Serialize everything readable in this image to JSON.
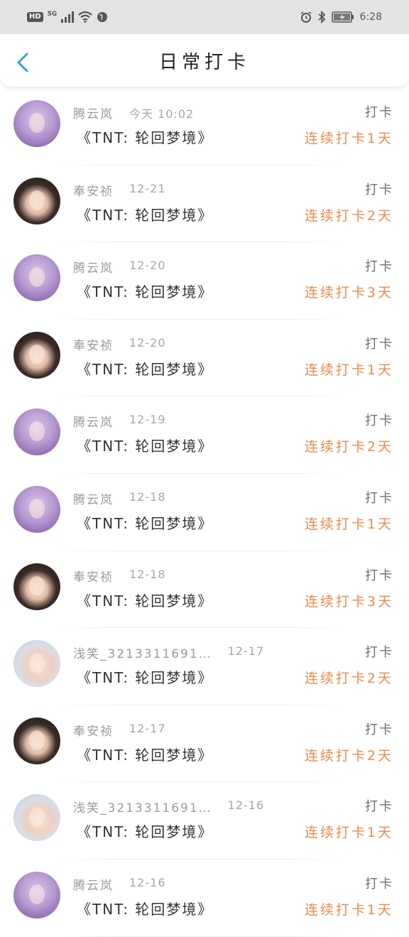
{
  "status_bar": {
    "hd": "HD",
    "network": "5G",
    "time": "6:28"
  },
  "header": {
    "title": "日常打卡"
  },
  "colors": {
    "accent": "#ec8a4c",
    "back_arrow": "#2f9ee0"
  },
  "items": [
    {
      "avatar": "purple-girl-avatar",
      "name": "腾云岚",
      "time": "今天 10:02",
      "tag": "打卡",
      "book": "《TNT: 轮回梦境》",
      "streak": "连续打卡1天"
    },
    {
      "avatar": "dark-hair-girl-avatar",
      "name": "奉安祯",
      "time": "12-21",
      "tag": "打卡",
      "book": "《TNT: 轮回梦境》",
      "streak": "连续打卡2天"
    },
    {
      "avatar": "purple-girl-avatar",
      "name": "腾云岚",
      "time": "12-20",
      "tag": "打卡",
      "book": "《TNT: 轮回梦境》",
      "streak": "连续打卡3天"
    },
    {
      "avatar": "dark-hair-girl-avatar",
      "name": "奉安祯",
      "time": "12-20",
      "tag": "打卡",
      "book": "《TNT: 轮回梦境》",
      "streak": "连续打卡1天"
    },
    {
      "avatar": "purple-girl-avatar",
      "name": "腾云岚",
      "time": "12-19",
      "tag": "打卡",
      "book": "《TNT: 轮回梦境》",
      "streak": "连续打卡2天"
    },
    {
      "avatar": "purple-girl-avatar",
      "name": "腾云岚",
      "time": "12-18",
      "tag": "打卡",
      "book": "《TNT: 轮回梦境》",
      "streak": "连续打卡1天"
    },
    {
      "avatar": "dark-hair-girl-avatar",
      "name": "奉安祯",
      "time": "12-18",
      "tag": "打卡",
      "book": "《TNT: 轮回梦境》",
      "streak": "连续打卡3天"
    },
    {
      "avatar": "boy-avatar",
      "name": "浅笑_3213311691…",
      "time": "12-17",
      "tag": "打卡",
      "book": "《TNT: 轮回梦境》",
      "streak": "连续打卡2天"
    },
    {
      "avatar": "dark-hair-girl-avatar",
      "name": "奉安祯",
      "time": "12-17",
      "tag": "打卡",
      "book": "《TNT: 轮回梦境》",
      "streak": "连续打卡2天"
    },
    {
      "avatar": "boy-avatar",
      "name": "浅笑_3213311691…",
      "time": "12-16",
      "tag": "打卡",
      "book": "《TNT: 轮回梦境》",
      "streak": "连续打卡1天"
    },
    {
      "avatar": "purple-girl-avatar",
      "name": "腾云岚",
      "time": "12-16",
      "tag": "打卡",
      "book": "《TNT: 轮回梦境》",
      "streak": "连续打卡1天"
    }
  ]
}
